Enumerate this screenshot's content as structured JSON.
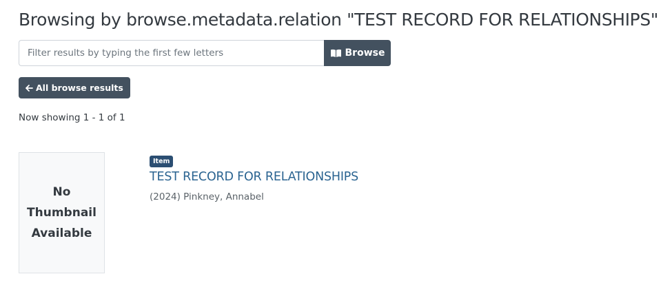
{
  "header": {
    "title": "Browsing by browse.metadata.relation \"TEST RECORD FOR RELATIONSHIPS\""
  },
  "filter": {
    "placeholder": "Filter results by typing the first few letters",
    "value": "",
    "button_label": "Browse",
    "button_icon": "book-open-icon"
  },
  "back_button": {
    "label": "All browse results",
    "icon": "arrow-left-icon"
  },
  "results": {
    "showing_text": "Now showing 1 - 1 of 1",
    "items": [
      {
        "thumbnail_text": "No Thumbnail Available",
        "badge": "Item",
        "title": "TEST RECORD FOR RELATIONSHIPS",
        "meta": "(2024) Pinkney, Annabel"
      }
    ]
  },
  "colors": {
    "button_bg": "#43515f",
    "badge_bg": "#2b4e72",
    "link": "#2b6491",
    "text": "#343a40"
  }
}
